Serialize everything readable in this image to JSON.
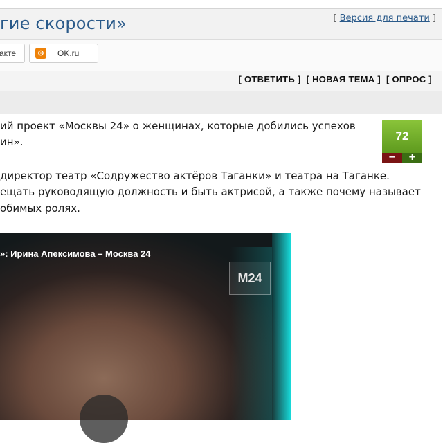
{
  "header": {
    "title": "гие скорости»",
    "print_link_open": "[ ",
    "print_link": "Версия для печати",
    "print_link_close": " ]"
  },
  "share": {
    "vk_label": "акте",
    "ok_icon": "ok-icon",
    "ok_label": "OK.ru"
  },
  "actions": {
    "reply": "[ ОТВЕТИТЬ ]",
    "new_topic": "[ НОВАЯ ТЕМА ]",
    "poll": "[ ОПРОС ]"
  },
  "post": {
    "lines": [
      "ий проект «Москвы 24» о женщинах, которые добились успехов",
      "ин».",
      "директор театр «Содружество актёров Таганки» и театра на Таганке.",
      "ещать руководящую должность и быть актрисой, а также почему называет",
      "обимых ролях."
    ],
    "rating": {
      "value": "72",
      "minus": "−",
      "plus": "+"
    }
  },
  "video": {
    "title": "»: Ирина Апексимова – Москва 24",
    "logo": "M24"
  },
  "colors": {
    "title": "#2a5a8a",
    "rating_green": "#6aab27",
    "rating_minus": "#7a1414",
    "rating_plus": "#3b6e13",
    "video_cyan": "#18e0e0"
  }
}
